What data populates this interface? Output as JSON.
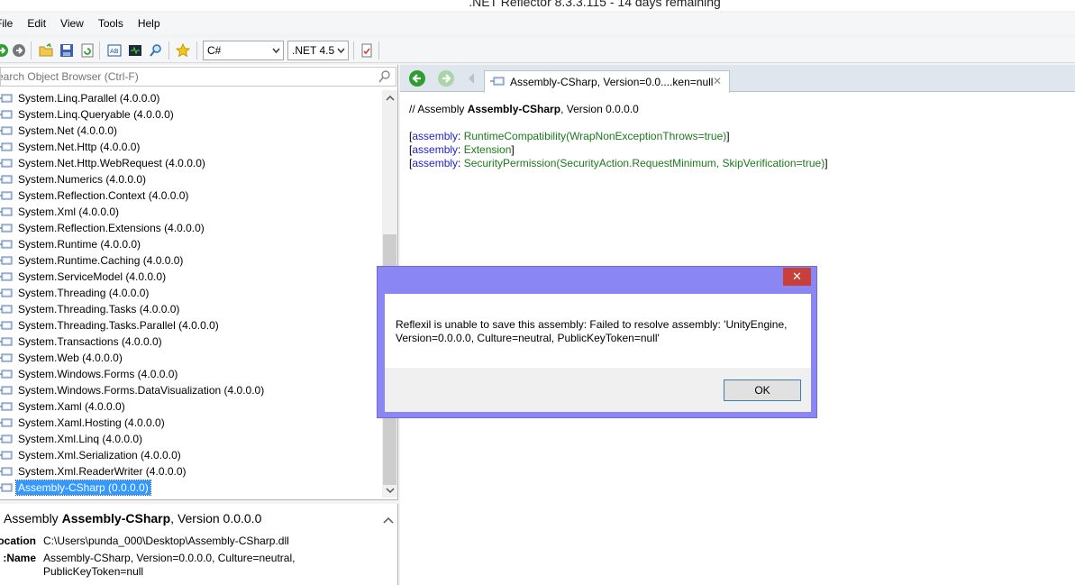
{
  "window": {
    "title": ".NET Reflector 8.3.3.115 - 14 days remaining"
  },
  "menu": [
    "File",
    "Edit",
    "View",
    "Tools",
    "Help"
  ],
  "toolbar": {
    "language": "C#",
    "framework": ".NET 4.5",
    "icons": [
      "forward-icon",
      "back-icon",
      "open-folder-icon",
      "save-icon",
      "refresh-icon",
      "analyzer-icon",
      "terminal-icon",
      "search-icon",
      "star-icon",
      "report-icon"
    ]
  },
  "search": {
    "placeholder": "Search Object Browser (Ctrl-F)"
  },
  "tree": {
    "items": [
      "System.Linq.Parallel (4.0.0.0)",
      "System.Linq.Queryable (4.0.0.0)",
      "System.Net (4.0.0.0)",
      "System.Net.Http (4.0.0.0)",
      "System.Net.Http.WebRequest (4.0.0.0)",
      "System.Numerics (4.0.0.0)",
      "System.Reflection.Context (4.0.0.0)",
      "System.Xml (4.0.0.0)",
      "System.Reflection.Extensions (4.0.0.0)",
      "System.Runtime (4.0.0.0)",
      "System.Runtime.Caching (4.0.0.0)",
      "System.ServiceModel (4.0.0.0)",
      "System.Threading (4.0.0.0)",
      "System.Threading.Tasks (4.0.0.0)",
      "System.Threading.Tasks.Parallel (4.0.0.0)",
      "System.Transactions (4.0.0.0)",
      "System.Web (4.0.0.0)",
      "System.Windows.Forms (4.0.0.0)",
      "System.Windows.Forms.DataVisualization (4.0.0.0)",
      "System.Xaml (4.0.0.0)",
      "System.Xaml.Hosting (4.0.0.0)",
      "System.Xml.Linq (4.0.0.0)",
      "System.Xml.Serialization (4.0.0.0)",
      "System.Xml.ReaderWriter (4.0.0.0)",
      "Assembly-CSharp (0.0.0.0)"
    ],
    "selected_index": 24
  },
  "info": {
    "prefix": "Assembly",
    "name": "Assembly-CSharp",
    "version": ", Version 0.0.0.0",
    "location_label": "Location:",
    "location_value": "C:\\Users\\punda_000\\Desktop\\Assembly-CSharp.dll",
    "name_label": "Name:",
    "name_value": "Assembly-CSharp, Version=0.0.0.0, Culture=neutral, PublicKeyToken=null"
  },
  "tab": {
    "label": "Assembly-CSharp, Version=0.0....ken=null",
    "close": "✕"
  },
  "code": {
    "comment_prefix": "// Assembly ",
    "comment_name": "Assembly-CSharp",
    "comment_suffix": ", Version 0.0.0.0",
    "lines": [
      {
        "kw": "assembly",
        "rest": "RuntimeCompatibility(WrapNonExceptionThrows=true)"
      },
      {
        "kw": "assembly",
        "rest": "Extension"
      },
      {
        "kw": "assembly",
        "rest": "SecurityPermission(SecurityAction.RequestMinimum, SkipVerification=true)"
      }
    ]
  },
  "dialog": {
    "message": "Reflexil is unable to save this assembly: Failed to resolve assembly: 'UnityEngine, Version=0.0.0.0, Culture=neutral, PublicKeyToken=null'",
    "ok_label": "OK",
    "close": "✕"
  },
  "colors": {
    "dialog_frame": "#8a86f4",
    "close_red": "#c7403a",
    "selection": "#3399ff",
    "keyword": "#1f1fd0",
    "attribute": "#1a7a1a"
  }
}
